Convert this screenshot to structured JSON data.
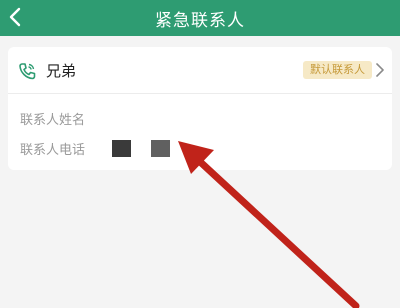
{
  "header": {
    "title": "紧急联系人"
  },
  "contact": {
    "relation": "兄弟",
    "badge": "默认联系人",
    "name_label": "联系人姓名",
    "phone_label": "联系人电话"
  },
  "colors": {
    "header_bg": "#2e9c72",
    "badge_bg": "#f6e9c6",
    "badge_text": "#c69a3a",
    "arrow": "#c0231a"
  },
  "icons": [
    "back-arrow-icon",
    "phone-icon",
    "chevron-right-icon"
  ]
}
